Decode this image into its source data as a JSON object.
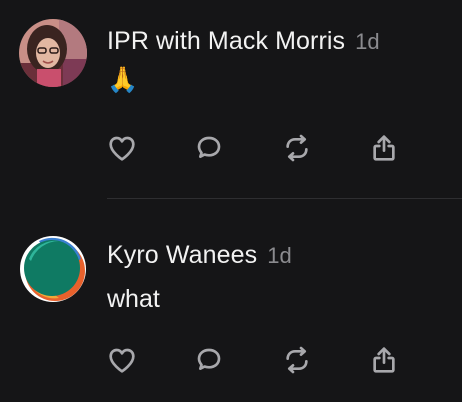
{
  "posts": [
    {
      "author": "IPR with Mack Morris",
      "time": "1d",
      "text": "🙏"
    },
    {
      "author": "Kyro Wanees",
      "time": "1d",
      "text": "what"
    }
  ],
  "icons": {
    "like": "heart-icon",
    "comment": "speech-bubble-icon",
    "repost": "repost-icon",
    "share": "share-icon"
  },
  "colors": {
    "background": "#151517",
    "text": "#f2f2f2",
    "muted": "#8b8b8f",
    "icon": "#a8a8ac",
    "divider": "#2e2e31"
  }
}
